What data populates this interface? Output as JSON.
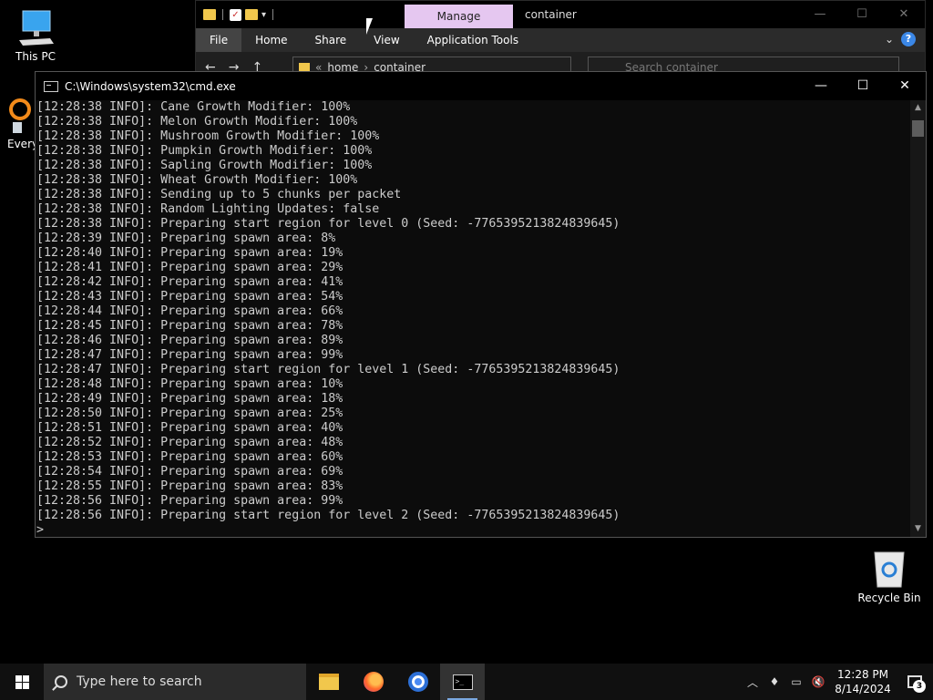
{
  "desktop": {
    "icons": [
      {
        "label": "This PC"
      },
      {
        "label": "Recycle Bin"
      },
      {
        "label": "Every"
      }
    ]
  },
  "explorer": {
    "manage_tab": "Manage",
    "title": "container",
    "ribbon_tabs": [
      "File",
      "Home",
      "Share",
      "View",
      "Application Tools"
    ],
    "address": {
      "crumbs": [
        "home",
        "container"
      ]
    },
    "search_placeholder": "Search container",
    "help_icon": "?"
  },
  "cmd": {
    "title": "C:\\Windows\\system32\\cmd.exe",
    "lines": [
      "[12:28:38 INFO]: Cane Growth Modifier: 100%",
      "[12:28:38 INFO]: Melon Growth Modifier: 100%",
      "[12:28:38 INFO]: Mushroom Growth Modifier: 100%",
      "[12:28:38 INFO]: Pumpkin Growth Modifier: 100%",
      "[12:28:38 INFO]: Sapling Growth Modifier: 100%",
      "[12:28:38 INFO]: Wheat Growth Modifier: 100%",
      "[12:28:38 INFO]: Sending up to 5 chunks per packet",
      "[12:28:38 INFO]: Random Lighting Updates: false",
      "[12:28:38 INFO]: Preparing start region for level 0 (Seed: -7765395213824839645)",
      "[12:28:39 INFO]: Preparing spawn area: 8%",
      "[12:28:40 INFO]: Preparing spawn area: 19%",
      "[12:28:41 INFO]: Preparing spawn area: 29%",
      "[12:28:42 INFO]: Preparing spawn area: 41%",
      "[12:28:43 INFO]: Preparing spawn area: 54%",
      "[12:28:44 INFO]: Preparing spawn area: 66%",
      "[12:28:45 INFO]: Preparing spawn area: 78%",
      "[12:28:46 INFO]: Preparing spawn area: 89%",
      "[12:28:47 INFO]: Preparing spawn area: 99%",
      "[12:28:47 INFO]: Preparing start region for level 1 (Seed: -7765395213824839645)",
      "[12:28:48 INFO]: Preparing spawn area: 10%",
      "[12:28:49 INFO]: Preparing spawn area: 18%",
      "[12:28:50 INFO]: Preparing spawn area: 25%",
      "[12:28:51 INFO]: Preparing spawn area: 40%",
      "[12:28:52 INFO]: Preparing spawn area: 48%",
      "[12:28:53 INFO]: Preparing spawn area: 60%",
      "[12:28:54 INFO]: Preparing spawn area: 69%",
      "[12:28:55 INFO]: Preparing spawn area: 83%",
      "[12:28:56 INFO]: Preparing spawn area: 99%",
      "[12:28:56 INFO]: Preparing start region for level 2 (Seed: -7765395213824839645)",
      ">"
    ]
  },
  "taskbar": {
    "search_placeholder": "Type here to search",
    "apps": [
      "file-explorer-icon",
      "firefox-icon",
      "chrome-icon",
      "cmd-icon"
    ],
    "clock": {
      "time": "12:28 PM",
      "date": "8/14/2024"
    },
    "notification_count": "3"
  }
}
